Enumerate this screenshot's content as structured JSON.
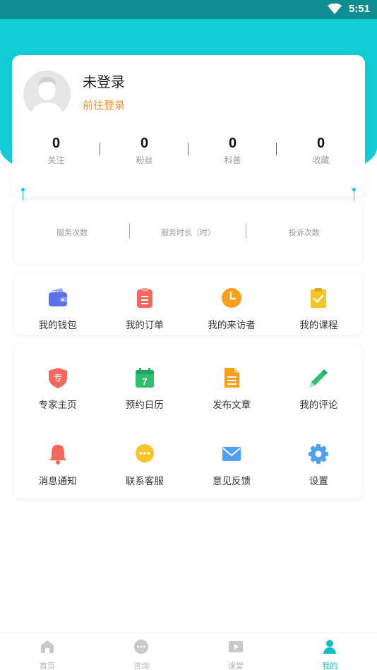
{
  "status_bar": {
    "time": "5:51"
  },
  "profile": {
    "username": "未登录",
    "login_link": "前往登录",
    "stats": [
      {
        "value": "0",
        "label": "关注"
      },
      {
        "value": "0",
        "label": "粉丝"
      },
      {
        "value": "0",
        "label": "科普"
      },
      {
        "value": "0",
        "label": "收藏"
      }
    ]
  },
  "service": {
    "items": [
      {
        "label": "服务次数"
      },
      {
        "label": "服务时长（时）"
      },
      {
        "label": "投诉次数"
      }
    ]
  },
  "menu1": [
    {
      "label": "我的钱包",
      "icon": "wallet-icon"
    },
    {
      "label": "我的订单",
      "icon": "order-icon"
    },
    {
      "label": "我的来访者",
      "icon": "clock-icon"
    },
    {
      "label": "我的课程",
      "icon": "course-icon"
    }
  ],
  "menu2": [
    {
      "label": "专家主页",
      "icon": "expert-icon"
    },
    {
      "label": "预约日历",
      "icon": "calendar-icon"
    },
    {
      "label": "发布文章",
      "icon": "article-icon"
    },
    {
      "label": "我的评论",
      "icon": "pencil-icon"
    },
    {
      "label": "消息通知",
      "icon": "bell-icon"
    },
    {
      "label": "联系客服",
      "icon": "chat-icon"
    },
    {
      "label": "意见反馈",
      "icon": "mail-icon"
    },
    {
      "label": "设置",
      "icon": "gear-icon"
    }
  ],
  "icon_text": {
    "expert": "专",
    "calendar_day": "7"
  },
  "tabs": [
    {
      "label": "首页",
      "icon": "home-icon"
    },
    {
      "label": "咨询",
      "icon": "consult-icon"
    },
    {
      "label": "课堂",
      "icon": "video-icon"
    },
    {
      "label": "我的",
      "icon": "person-icon"
    }
  ],
  "colors": {
    "accent": "#12cdd5",
    "status_bar": "#0e8e92",
    "login_link": "#f0932b",
    "active_tab": "#12bfc8"
  }
}
